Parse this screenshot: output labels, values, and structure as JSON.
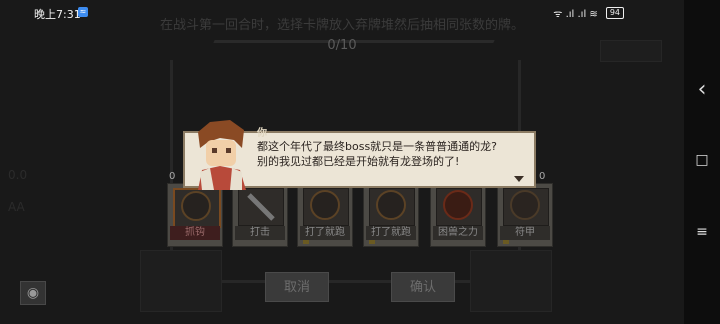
{
  "status_bar": {
    "time": "晚上7:31",
    "badge": "≈",
    "right_text": "ᯤ .ıl .ıl ≋",
    "battery": "94"
  },
  "game": {
    "hint_text": "在战斗第一回合时，选择卡牌放入弃牌堆然后抽相同张数的牌。",
    "selection_count": "0/10",
    "ghost_left_1": "0.0",
    "ghost_left_2": "AA",
    "cards": [
      {
        "label": "抓钩",
        "icon": "hook-icon"
      },
      {
        "label": "打击",
        "icon": "sword-icon"
      },
      {
        "label": "打了就跑",
        "icon": "dash-icon"
      },
      {
        "label": "打了就跑",
        "icon": "dash-icon"
      },
      {
        "label": "困兽之力",
        "icon": "flame-icon"
      },
      {
        "label": "符甲",
        "icon": "armor-icon"
      }
    ],
    "card_counter_left": "0",
    "card_counter_right": "0",
    "cancel_label": "取消",
    "confirm_label": "确认"
  },
  "dialog": {
    "speaker": "你",
    "line1": "都这个年代了最终boss就只是一条普普通通的龙?",
    "line2": "别的我见过都已经是开始就有龙登场的了!"
  },
  "nav": {
    "back": "‹",
    "home": "□",
    "menu": "≡"
  },
  "colors": {
    "dialog_bg": "#ece5d6",
    "card_bg": "#4c4a45"
  }
}
